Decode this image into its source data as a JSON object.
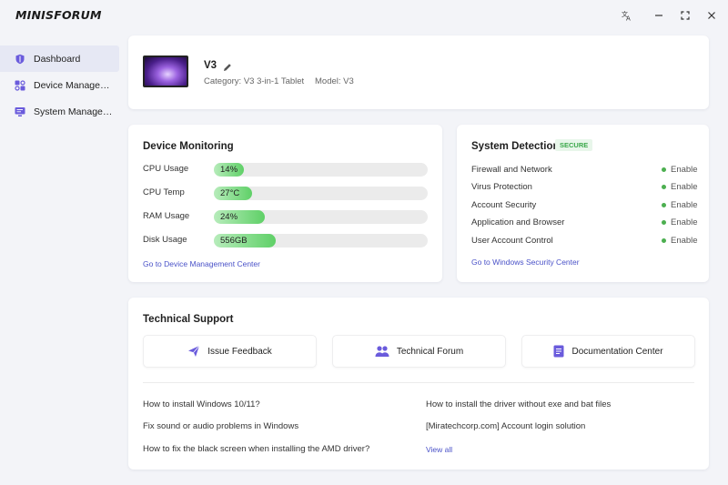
{
  "app": {
    "brand": "MINISFORUM"
  },
  "sidebar": {
    "items": [
      {
        "label": "Dashboard"
      },
      {
        "label": "Device Manage…"
      },
      {
        "label": "System Manage…"
      }
    ]
  },
  "device": {
    "name": "V3",
    "category": "Category: V3 3-in-1 Tablet",
    "model": "Model: V3"
  },
  "monitoring": {
    "title": "Device Monitoring",
    "rows": [
      {
        "label": "CPU Usage",
        "value": "14%",
        "fill": 0.14
      },
      {
        "label": "CPU Temp",
        "value": "27°C",
        "fill": 0.18
      },
      {
        "label": "RAM Usage",
        "value": "24%",
        "fill": 0.24
      },
      {
        "label": "Disk Usage",
        "value": "556GB",
        "fill": 0.29
      }
    ],
    "link": "Go to Device Management Center"
  },
  "detection": {
    "title": "System Detection",
    "badge": "SECURE",
    "rows": [
      {
        "label": "Firewall and Network",
        "status": "Enable"
      },
      {
        "label": "Virus Protection",
        "status": "Enable"
      },
      {
        "label": "Account Security",
        "status": "Enable"
      },
      {
        "label": "Application and Browser",
        "status": "Enable"
      },
      {
        "label": "User Account Control",
        "status": "Enable"
      }
    ],
    "link": "Go to Windows Security Center",
    "colors": {
      "accent": "#4caf50",
      "badge_bg": "#e8f6ea"
    }
  },
  "support": {
    "title": "Technical Support",
    "buttons": [
      {
        "label": "Issue Feedback",
        "icon": "paper-plane-icon"
      },
      {
        "label": "Technical Forum",
        "icon": "people-icon"
      },
      {
        "label": "Documentation Center",
        "icon": "document-icon"
      }
    ],
    "faq_left": [
      "How to install Windows 10/11?",
      "Fix sound or audio problems in Windows",
      "How to fix the black screen when installing the AMD driver?"
    ],
    "faq_right": [
      "How to install the driver without exe and bat files",
      "[Miratechcorp.com] Account login solution"
    ],
    "view_all": "View all",
    "colors": {
      "icon": "#6a5bdc"
    }
  }
}
